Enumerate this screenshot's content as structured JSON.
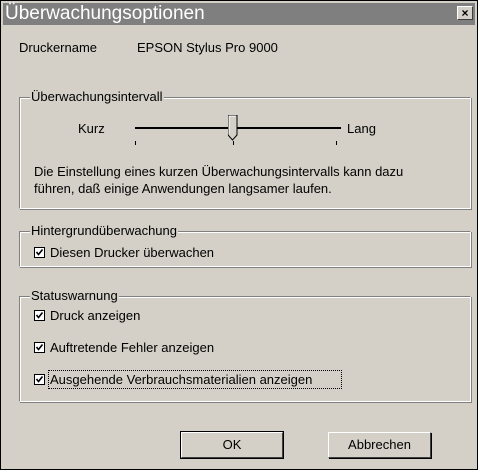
{
  "window": {
    "title": "Überwachungsoptionen",
    "close_label": "×"
  },
  "printer": {
    "label": "Druckername",
    "value": "EPSON Stylus Pro 9000"
  },
  "interval": {
    "group_title": "Überwachungsintervall",
    "min_label": "Kurz",
    "max_label": "Lang",
    "slider_value": 0.5,
    "description_line1": "Die Einstellung eines kurzen Überwachungsintervalls kann dazu",
    "description_line2": "führen, daß einige Anwendungen langsamer laufen."
  },
  "background": {
    "group_title": "Hintergrundüberwachung",
    "checkbox_label": "Diesen Drucker überwachen",
    "checked": true
  },
  "status": {
    "group_title": "Statuswarnung",
    "items": [
      {
        "label": "Druck anzeigen",
        "checked": true
      },
      {
        "label": "Auftretende Fehler anzeigen",
        "checked": true
      },
      {
        "label": "Ausgehende Verbrauchsmaterialien anzeigen",
        "checked": true
      }
    ]
  },
  "buttons": {
    "ok_label": "OK",
    "cancel_label": "Abbrechen"
  }
}
